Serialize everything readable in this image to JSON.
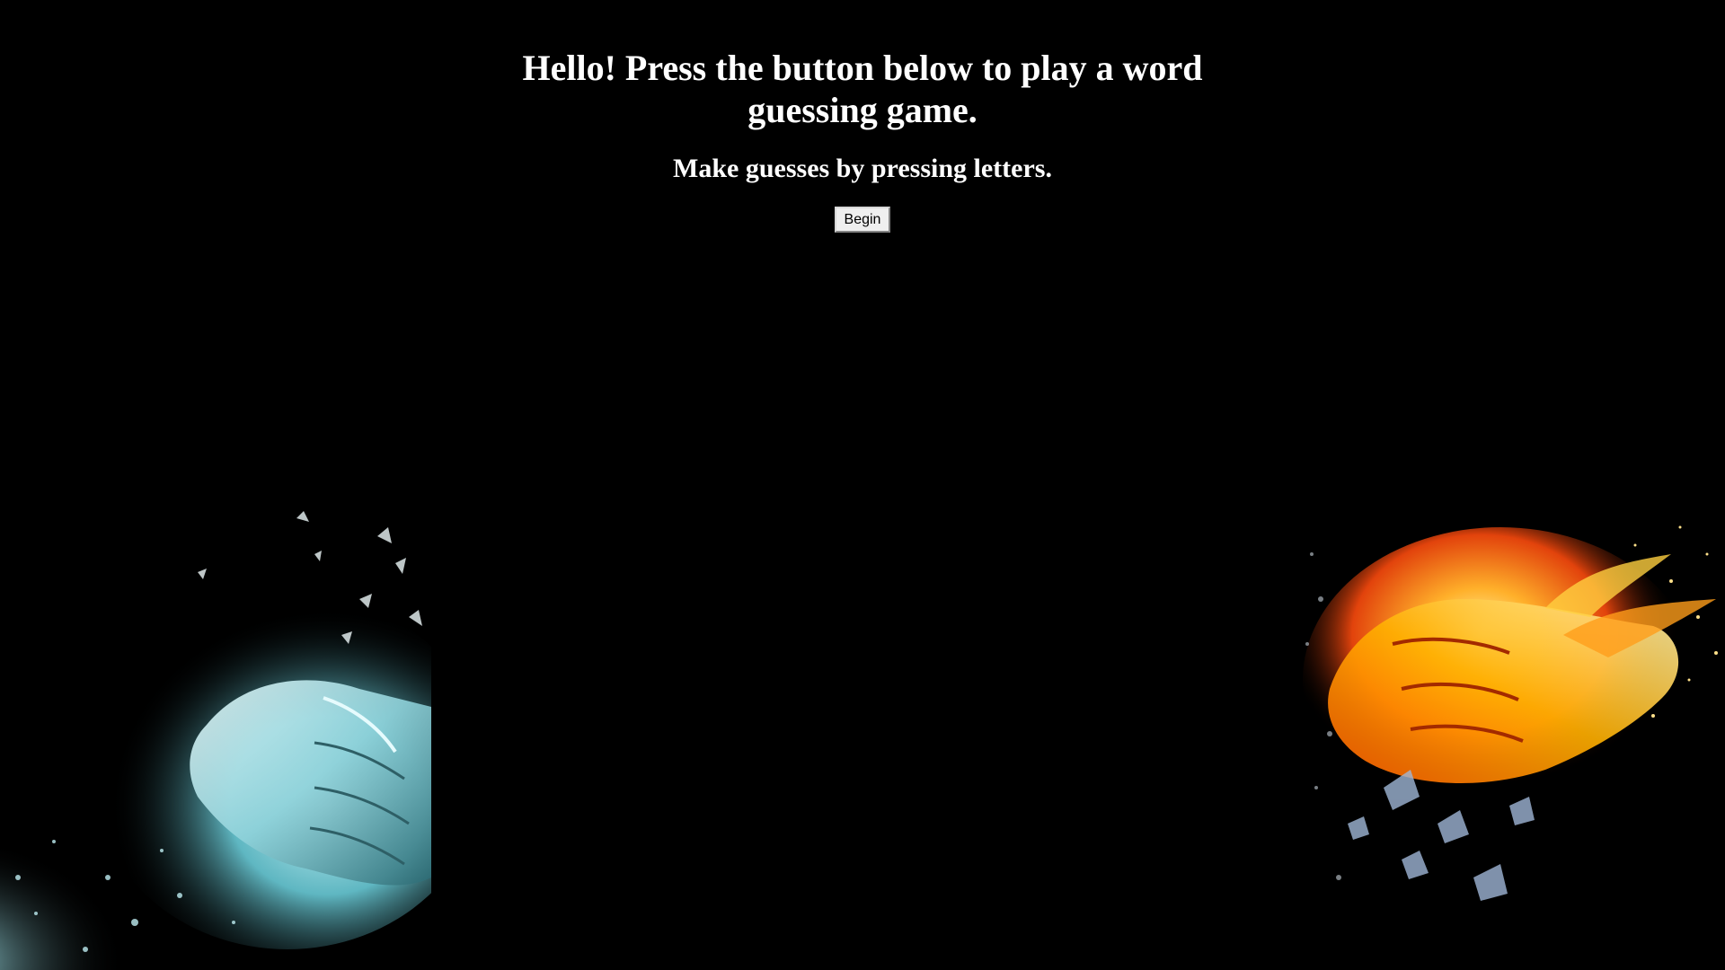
{
  "intro": {
    "title": "Hello! Press the button below to play a word guessing game.",
    "subtitle": "Make guesses by pressing letters.",
    "begin_label": "Begin"
  },
  "artwork": {
    "left": {
      "icon": "ice-fist-image",
      "accent": "#7fd6e0"
    },
    "right": {
      "icon": "fire-fist-image",
      "accent": "#ff8a1a"
    }
  },
  "colors": {
    "background": "#000000",
    "text": "#ffffff"
  }
}
